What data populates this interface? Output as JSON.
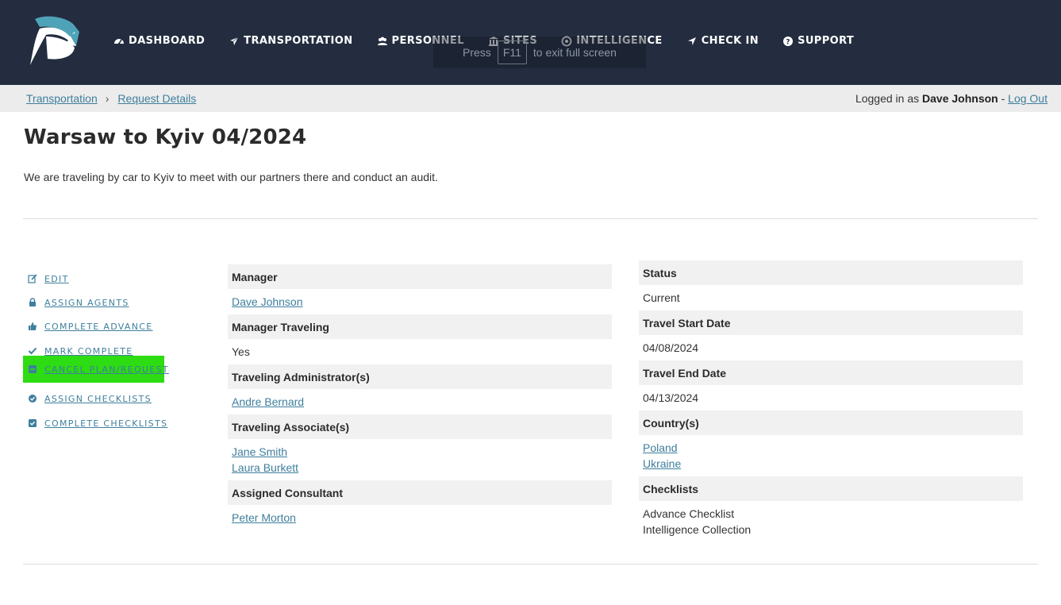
{
  "nav": {
    "items": [
      {
        "label": "DASHBOARD",
        "icon": "dashboard-icon"
      },
      {
        "label": "TRANSPORTATION",
        "icon": "plane-icon"
      },
      {
        "label": "PERSONNEL",
        "icon": "users-icon"
      },
      {
        "label": "SITES",
        "icon": "building-icon"
      },
      {
        "label": "INTELLIGENCE",
        "icon": "target-icon"
      },
      {
        "label": "CHECK IN",
        "icon": "location-arrow-icon"
      },
      {
        "label": "SUPPORT",
        "icon": "question-circle-icon"
      }
    ]
  },
  "overlay": {
    "press": "Press",
    "key": "F11",
    "rest": "to exit full screen"
  },
  "breadcrumb": {
    "items": [
      "Transportation",
      "Request Details"
    ],
    "separator": "›"
  },
  "session": {
    "prefix": "Logged in as",
    "user": "Dave Johnson",
    "dash": "-",
    "logout": "Log Out"
  },
  "page": {
    "title": "Warsaw to Kyiv 04/2024",
    "description": "We are traveling by car to Kyiv to meet with our partners there and conduct an audit."
  },
  "actions": [
    {
      "label": "EDIT",
      "icon": "edit-icon"
    },
    {
      "label": "ASSIGN AGENTS",
      "icon": "lock-icon"
    },
    {
      "label": "COMPLETE ADVANCE",
      "icon": "thumbs-up-icon"
    },
    {
      "label": "MARK COMPLETE",
      "icon": "checkmark-icon"
    },
    {
      "label": "CANCEL PLAN/REQUEST",
      "icon": "minus-square-icon"
    },
    {
      "label": "ASSIGN CHECKLISTS",
      "icon": "check-circle-icon"
    },
    {
      "label": "COMPLETE CHECKLISTS",
      "icon": "check-square-icon"
    }
  ],
  "details_left": {
    "manager": {
      "label": "Manager",
      "value": "Dave Johnson"
    },
    "manager_traveling": {
      "label": "Manager Traveling",
      "value": "Yes"
    },
    "admins": {
      "label": "Traveling Administrator(s)",
      "values": [
        "Andre Bernard"
      ]
    },
    "associates": {
      "label": "Traveling Associate(s)",
      "values": [
        "Jane Smith",
        "Laura Burkett"
      ]
    },
    "consultant": {
      "label": "Assigned Consultant",
      "value": "Peter Morton"
    }
  },
  "details_right": {
    "status": {
      "label": "Status",
      "value": "Current"
    },
    "start": {
      "label": "Travel Start Date",
      "value": "04/08/2024"
    },
    "end": {
      "label": "Travel End Date",
      "value": "04/13/2024"
    },
    "countries": {
      "label": "Country(s)",
      "values": [
        "Poland",
        "Ukraine"
      ]
    },
    "checklists": {
      "label": "Checklists",
      "values": [
        "Advance Checklist",
        "Intelligence Collection"
      ]
    }
  },
  "colors": {
    "navbar": "#232d3f",
    "link": "#3e7f9d",
    "highlight": "#2ddc12",
    "logo": "#4fa3b8"
  }
}
